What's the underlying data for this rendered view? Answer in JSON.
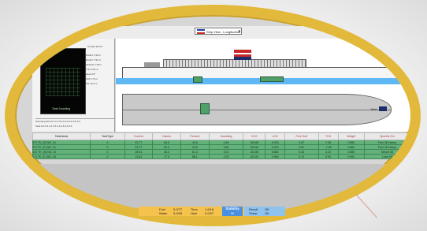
{
  "toolbar": {
    "vessel_select_value": "Ship View - Longitudinal"
  },
  "left_panel": {
    "condition_title": "Current Inform",
    "conditions": [
      {
        "label": "Draft A",
        "value": "7.93 m"
      },
      {
        "label": "Draft F",
        "value": "7.62 m"
      },
      {
        "label": "Draft M",
        "value": "7.78 m"
      },
      {
        "label": "Trim",
        "value": "0.31 m"
      },
      {
        "label": "Heel",
        "value": "0.5°"
      },
      {
        "label": "GM",
        "value": "1.74 m"
      },
      {
        "label": "KG",
        "value": "13.2 m"
      }
    ],
    "black_box_label": "Tank Sounding",
    "footer_line_1": "Sounding Alt  0.5  1.0  1.5  2.0  2.5  3.0  3.5  4.0",
    "footer_line_2": "Tank     0.0  0.5  1.0  1.5  2.0  2.5  3.0  3.5"
  },
  "profile": {
    "axis_label": "Mass",
    "axis_button_label": "Set"
  },
  "table": {
    "headers": [
      "TankName",
      "TankType",
      "Current",
      "Volume",
      "Percent",
      "Sounding",
      "VCG",
      "LCG",
      "Free Surf",
      "TCG",
      "Weight",
      "Specific Grv"
    ],
    "rows": [
      [
        "FO TK. (S) NO. 01",
        "0",
        "43.77",
        "69.0",
        "42.6",
        "4.64",
        "105.66",
        "9.220",
        "0.87",
        "7.48",
        "0.850",
        "Fuel Oil Heavy"
      ],
      [
        "FO TK. (P) NO. 01",
        "0",
        "43.77",
        "69.0",
        "42.6",
        "4.64",
        "105.66",
        "9.220",
        "0.87",
        "-7.48",
        "0.850",
        "Fuel Oil Heavy"
      ],
      [
        "DO TK. (S) NO. 02",
        "0",
        "28.01",
        "45.2",
        "61.3",
        "3.01",
        "131.85",
        "6.880",
        "0.43",
        "4.10",
        "0.880",
        "Diesel Oil"
      ],
      [
        "LO TK. (C) NO. 03",
        "0",
        "15.42",
        "17.5",
        "88.1",
        "2.20",
        "142.09",
        "2.960",
        "0.12",
        "0.00",
        "0.900",
        "Lube Oil"
      ]
    ]
  },
  "status": {
    "fuel_label": "Fuel",
    "fuel_value": "0.0/77",
    "water_label": "Water",
    "water_value": "0.0/08",
    "time_label": "Time",
    "time_value": "1.6/18",
    "heel_label": "Heel",
    "heel_value": "0.0/07",
    "stability_label": "Stability",
    "stability_sub": "0K",
    "result_1_label": "Result",
    "result_1_value": "OK",
    "result_2_label": "Shear",
    "result_2_value": "OK"
  },
  "colors": {
    "frame": "#e2b93b",
    "tank_fill": "#62b27a",
    "status_bar": "#f6c24e",
    "stability": "#4a90e0",
    "water": "#5fb8f3"
  }
}
